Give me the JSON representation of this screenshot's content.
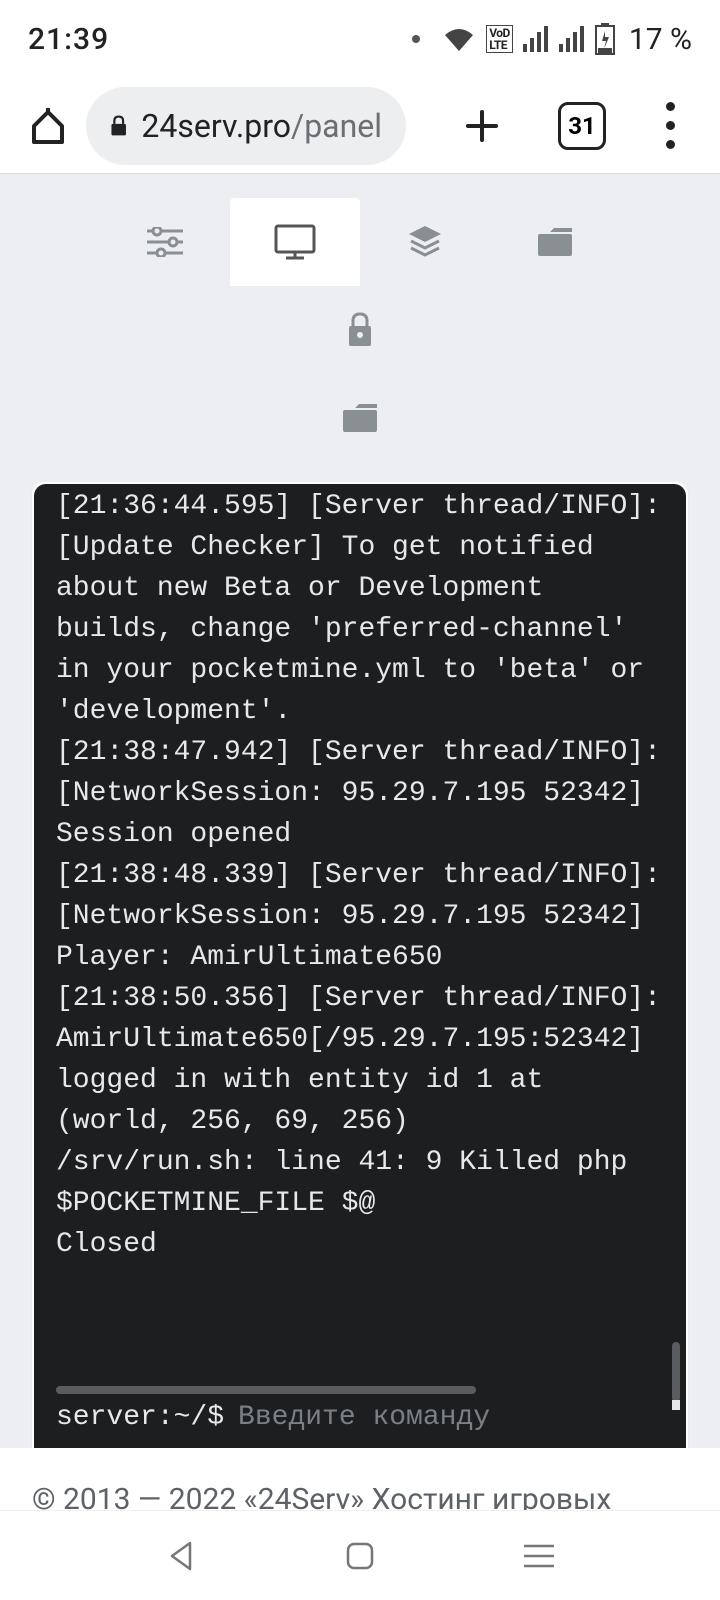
{
  "status": {
    "time": "21:39",
    "volte_label": "VoLTE",
    "battery_pct": "17 %"
  },
  "browser": {
    "url_host": "24serv.pro",
    "url_path": "/panel",
    "tab_count": "31"
  },
  "tabs": {
    "settings": "settings-icon",
    "console": "console-icon",
    "layers": "layers-icon",
    "folder1": "folder-icon",
    "lock": "lock-icon",
    "folder2": "folder-icon"
  },
  "console": {
    "log": "[21:36:44.595] [Server thread/INFO]: [Update Checker] To get notified about new Beta or Development builds, change 'preferred-channel' in your pocketmine.yml to 'beta' or 'development'.\n[21:38:47.942] [Server thread/INFO]: [NetworkSession: 95.29.7.195 52342] Session opened\n[21:38:48.339] [Server thread/INFO]: [NetworkSession: 95.29.7.195 52342] Player: AmirUltimate650\n[21:38:50.356] [Server thread/INFO]: AmirUltimate650[/95.29.7.195:52342] logged in with entity id 1 at (world, 256, 69, 256)\n/srv/run.sh: line 41: 9 Killed php $POCKETMINE_FILE $@\nClosed",
    "prompt_prefix": "server:~/$",
    "prompt_placeholder": "Введите команду"
  },
  "footer": {
    "text": "© 2013 — 2022 «24Serv» Хостинг игровых"
  }
}
